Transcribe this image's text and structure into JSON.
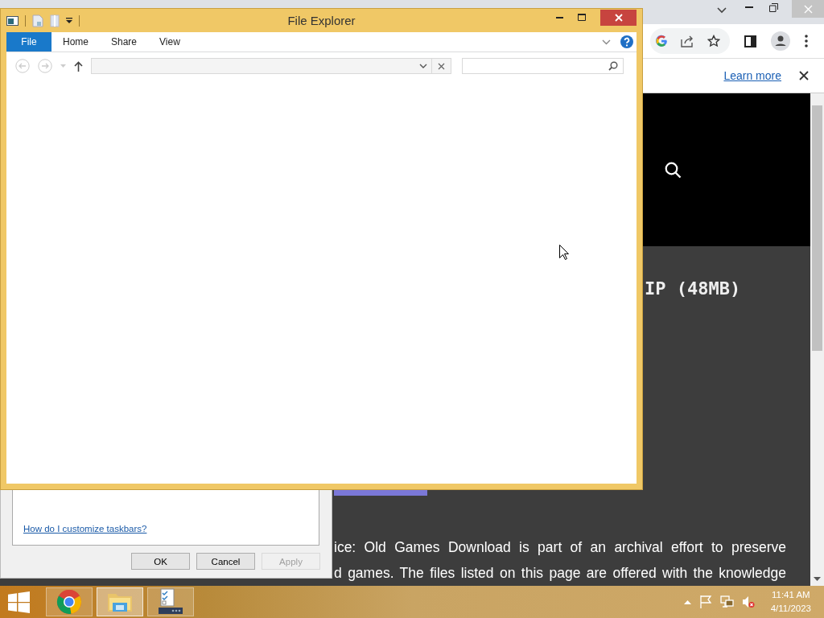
{
  "explorer": {
    "title": "File Explorer",
    "tabs": [
      {
        "label": "File",
        "selected": true
      },
      {
        "label": "Home",
        "selected": false
      },
      {
        "label": "Share",
        "selected": false
      },
      {
        "label": "View",
        "selected": false
      }
    ]
  },
  "browser": {
    "infobar_link": "Learn more",
    "heading": "IP (48MB)",
    "notice_lines": [
      "ice: Old Games Download is part of an archival effort to preserve",
      "d games. The files listed on this page are offered with the knowledge"
    ]
  },
  "dialog": {
    "link": "How do I customize taskbars?",
    "buttons": [
      {
        "label": "OK",
        "disabled": false
      },
      {
        "label": "Cancel",
        "disabled": false
      },
      {
        "label": "Apply",
        "disabled": true
      }
    ]
  },
  "taskbar": {
    "apps": [
      {
        "kind": "chrome",
        "selected": false
      },
      {
        "kind": "explorer",
        "selected": true
      },
      {
        "kind": "tasks",
        "selected": false
      }
    ],
    "time": "11:41 AM",
    "date": "4/11/2023"
  }
}
